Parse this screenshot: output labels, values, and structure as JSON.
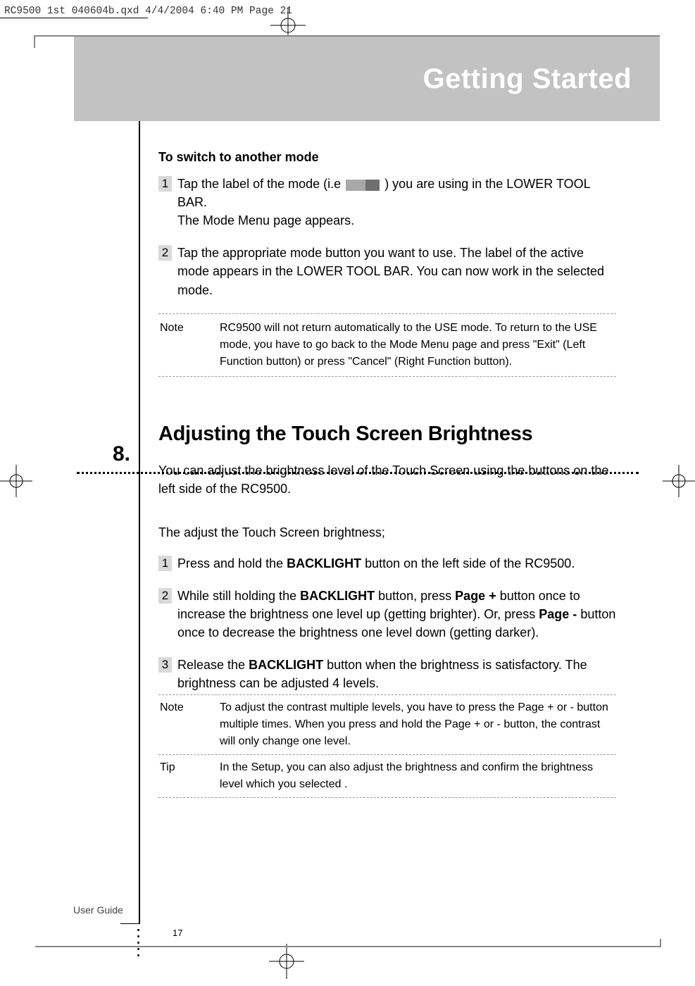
{
  "meta": {
    "file_stamp": "RC9500 1st 040604b.qxd  4/4/2004  6:40 PM  Page 21"
  },
  "chapter_title": "Getting Started",
  "section1": {
    "subhead": "To switch to another mode",
    "step1_a": "Tap the label of the mode (i.e",
    "step1_b": ") you are using in the LOWER TOOL BAR.",
    "step1_c": "The Mode Menu page appears.",
    "step2": "Tap the appropriate mode button you want to use. The label of the active mode appears in the LOWER TOOL BAR.  You can now work in the selected mode.",
    "note_label": "Note",
    "note_body": "RC9500 will not return automatically to the USE mode. To return to the USE mode, you have to go back to the Mode Menu page and press \"Exit\" (Left Function button) or press \"Cancel\" (Right Function button)."
  },
  "section2": {
    "number": "8.",
    "heading": "Adjusting the Touch Screen Brightness",
    "intro": "You can adjust the brightness level of the Touch Screen using the buttons on the left side of the RC9500.",
    "lead": "The adjust the Touch Screen brightness;",
    "step1_a": "Press and hold the ",
    "step1_bold": "BACKLIGHT",
    "step1_b": " button on the left side of the RC9500.",
    "step2_a": "While still holding the ",
    "step2_bold1": "BACKLIGHT",
    "step2_b": " button, press ",
    "step2_bold2": "Page +",
    "step2_c": " button once to increase the brightness one level up (getting brighter). Or, press ",
    "step2_bold3": "Page -",
    "step2_d": " button once to decrease the brightness one level down (getting darker).",
    "step3_a": "Release the ",
    "step3_bold": "BACKLIGHT",
    "step3_b": " button when the brightness is satisfactory. The brightness can be adjusted 4 levels.",
    "note_label": "Note",
    "note_body": "To adjust the contrast multiple levels, you have to press the Page + or - button multiple times. When you press and hold the Page + or - button, the contrast will only change one level.",
    "tip_label": "Tip",
    "tip_body": "In the Setup, you can also adjust the brightness and confirm the brightness level which you selected ."
  },
  "footer": {
    "sidebar": "User Guide",
    "page": "17"
  }
}
